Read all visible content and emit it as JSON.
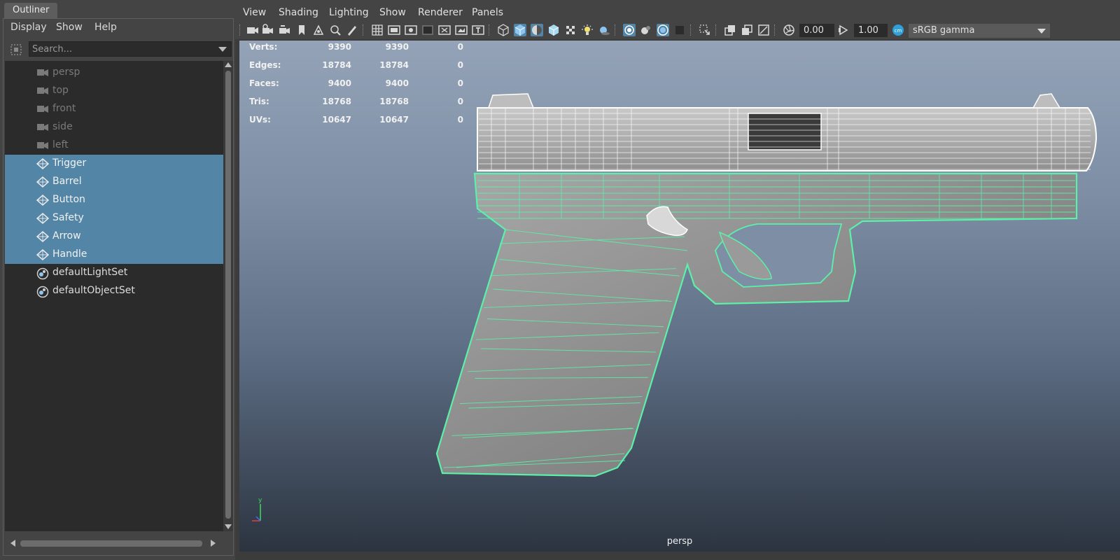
{
  "outliner": {
    "tab_label": "Outliner",
    "menu": [
      "Display",
      "Show",
      "Help"
    ],
    "search_placeholder": "Search...",
    "items": [
      {
        "label": "persp",
        "type": "camera"
      },
      {
        "label": "top",
        "type": "camera"
      },
      {
        "label": "front",
        "type": "camera"
      },
      {
        "label": "side",
        "type": "camera"
      },
      {
        "label": "left",
        "type": "camera"
      },
      {
        "label": "Trigger",
        "type": "mesh",
        "selected": true
      },
      {
        "label": "Barrel",
        "type": "mesh",
        "selected": true
      },
      {
        "label": "Button",
        "type": "mesh",
        "selected": true
      },
      {
        "label": "Safety",
        "type": "mesh",
        "selected": true
      },
      {
        "label": "Arrow",
        "type": "mesh",
        "selected": true
      },
      {
        "label": "Handle",
        "type": "mesh",
        "selected": true
      },
      {
        "label": "defaultLightSet",
        "type": "set"
      },
      {
        "label": "defaultObjectSet",
        "type": "set"
      }
    ]
  },
  "viewport": {
    "menu": [
      "View",
      "Shading",
      "Lighting",
      "Show",
      "Renderer",
      "Panels"
    ],
    "exposure": "0.00",
    "gamma": "1.00",
    "color_management": "sRGB gamma",
    "camera_name": "persp",
    "heads_up": [
      {
        "label": "Verts:",
        "values": [
          "9390",
          "9390",
          "0"
        ]
      },
      {
        "label": "Edges:",
        "values": [
          "18784",
          "18784",
          "0"
        ]
      },
      {
        "label": "Faces:",
        "values": [
          "9400",
          "9400",
          "0"
        ]
      },
      {
        "label": "Tris:",
        "values": [
          "18768",
          "18768",
          "0"
        ]
      },
      {
        "label": "UVs:",
        "values": [
          "10647",
          "10647",
          "0"
        ]
      }
    ],
    "axis_label": "y"
  },
  "colors": {
    "selection_highlight": "#5285a6",
    "wireframe_selected": "#5cf0a8",
    "wireframe_white": "#ffffff",
    "mesh_gray": "#8a8a8a"
  }
}
